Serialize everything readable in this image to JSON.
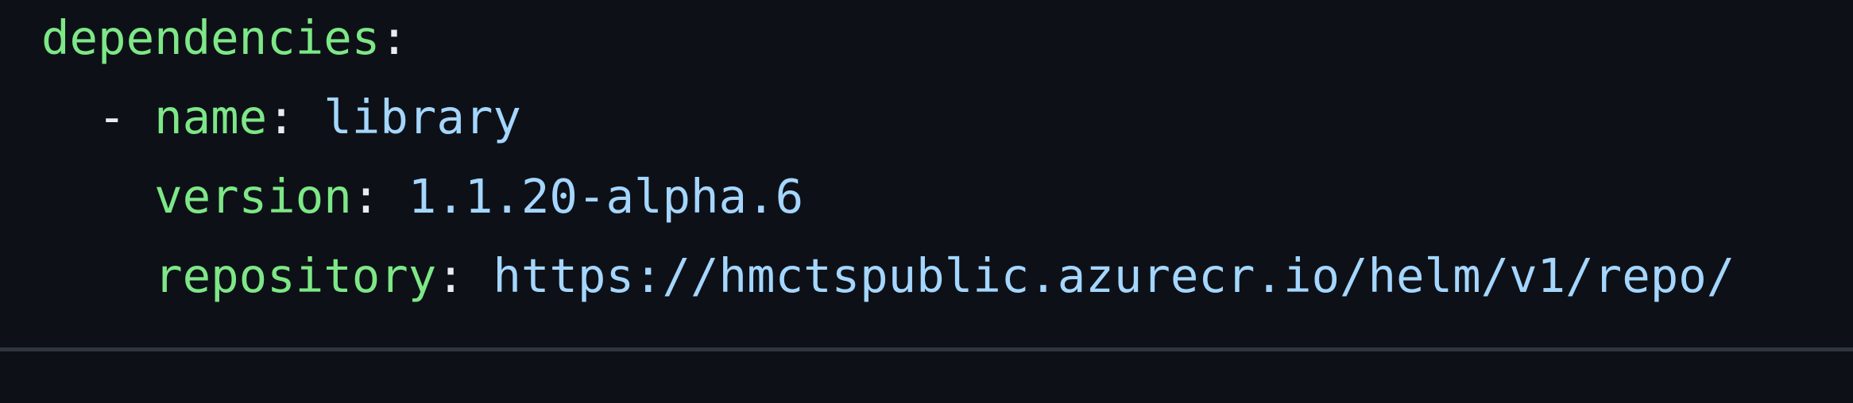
{
  "code": {
    "lines": [
      {
        "indent": "",
        "dash": "",
        "key": "dependencies",
        "colon": ":",
        "value": ""
      },
      {
        "indent": "  ",
        "dash": "- ",
        "key": "name",
        "colon": ": ",
        "value": "library"
      },
      {
        "indent": "    ",
        "dash": "",
        "key": "version",
        "colon": ": ",
        "value": "1.1.20-alpha.6"
      },
      {
        "indent": "    ",
        "dash": "",
        "key": "repository",
        "colon": ": ",
        "value": "https://hmctspublic.azurecr.io/helm/v1/repo/"
      }
    ]
  },
  "colors": {
    "background": "#0d1117",
    "key": "#7ee787",
    "value": "#a5d6ff",
    "punctuation": "#e6edf3",
    "divider": "#30363d"
  }
}
